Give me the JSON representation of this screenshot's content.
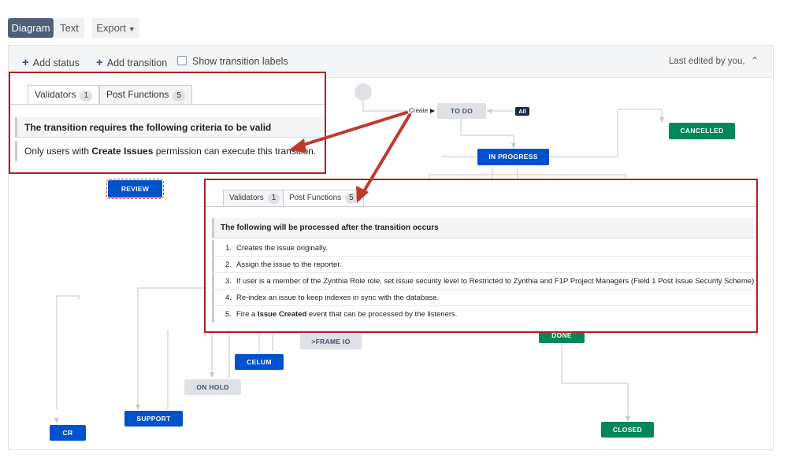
{
  "view_tabs": {
    "diagram": "Diagram",
    "text": "Text",
    "export": "Export"
  },
  "toolbar": {
    "add_status": "Add status",
    "add_transition": "Add transition",
    "show_labels": "Show transition labels",
    "last_edited": "Last edited by you,"
  },
  "diagram": {
    "transition_label": "Create",
    "all_badge": "All",
    "statuses": {
      "todo": "TO DO",
      "in_progress": "IN PROGRESS",
      "cancelled": "CANCELLED",
      "review": "REVIEW",
      "frame_io": ">FRAME IO",
      "done": "DONE",
      "celum": "CELUM",
      "on_hold": "ON HOLD",
      "support": "SUPPORT",
      "cr": "CR",
      "closed": "CLOSED"
    },
    "colors": {
      "blue": "#0052cc",
      "green": "#00875a",
      "grey": "#dfe1e6",
      "highlight": "#b21f1f"
    }
  },
  "validators_panel": {
    "tabs": [
      {
        "label": "Validators",
        "count": "1"
      },
      {
        "label": "Post Functions",
        "count": "5"
      }
    ],
    "header": "The transition requires the following criteria to be valid",
    "row": {
      "before": "Only users with ",
      "bold": "Create Issues",
      "after": " permission can execute this transition."
    }
  },
  "post_functions_panel": {
    "tabs": [
      {
        "label": "Validators",
        "count": "1"
      },
      {
        "label": "Post Functions",
        "count": "5"
      }
    ],
    "header": "The following will be processed after the transition occurs",
    "items": [
      {
        "num": "1.",
        "before": "Creates the issue originally.",
        "bold": "",
        "after": ""
      },
      {
        "num": "2.",
        "before": "Assign the issue to the reporter.",
        "bold": "",
        "after": ""
      },
      {
        "num": "3.",
        "before": "If user is a member of the Zynthia Role role, set issue security level to Restricted to Zynthia and F1P Project Managers (Field 1 Post Issue Security Scheme).",
        "bold": "",
        "after": ""
      },
      {
        "num": "4.",
        "before": "Re-index an issue to keep indexes in sync with the database.",
        "bold": "",
        "after": ""
      },
      {
        "num": "5.",
        "before": "Fire a ",
        "bold": "Issue Created",
        "after": " event that can be processed by the listeners."
      }
    ]
  }
}
